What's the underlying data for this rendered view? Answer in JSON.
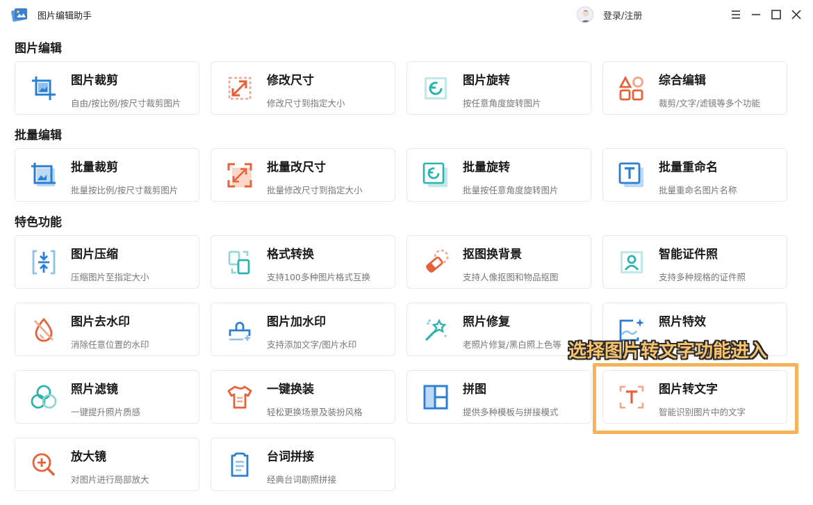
{
  "app": {
    "title": "图片编辑助手",
    "login_label": "登录/注册"
  },
  "sections": [
    {
      "title": "图片编辑"
    },
    {
      "title": "批量编辑"
    },
    {
      "title": "特色功能"
    }
  ],
  "cards": [
    {
      "title": "图片裁剪",
      "desc": "自由/按比例/按尺寸裁剪图片"
    },
    {
      "title": "修改尺寸",
      "desc": "修改尺寸到指定大小"
    },
    {
      "title": "图片旋转",
      "desc": "按任意角度旋转图片"
    },
    {
      "title": "综合编辑",
      "desc": "裁剪/文字/滤镜等多个功能"
    },
    {
      "title": "批量裁剪",
      "desc": "批量按比例/按尺寸裁剪图片"
    },
    {
      "title": "批量改尺寸",
      "desc": "批量修改尺寸到指定大小"
    },
    {
      "title": "批量旋转",
      "desc": "批量按任意角度旋转图片"
    },
    {
      "title": "批量重命名",
      "desc": "批量重命名图片名称"
    },
    {
      "title": "图片压缩",
      "desc": "压缩图片至指定大小"
    },
    {
      "title": "格式转换",
      "desc": "支持100多种图片格式互换"
    },
    {
      "title": "抠图换背景",
      "desc": "支持人像抠图和物品抠图"
    },
    {
      "title": "智能证件照",
      "desc": "支持多种规格的证件照"
    },
    {
      "title": "图片去水印",
      "desc": "消除任意位置的水印"
    },
    {
      "title": "图片加水印",
      "desc": "支持添加文字/图片水印"
    },
    {
      "title": "照片修复",
      "desc": "老照片修复/黑白照上色等"
    },
    {
      "title": "照片特效",
      "desc": ""
    },
    {
      "title": "照片滤镜",
      "desc": "一键提升照片质感"
    },
    {
      "title": "一键换装",
      "desc": "轻松更换场景及装扮风格"
    },
    {
      "title": "拼图",
      "desc": "提供多种模板与拼接模式"
    },
    {
      "title": "图片转文字",
      "desc": "智能识别图片中的文字"
    },
    {
      "title": "放大镜",
      "desc": "对图片进行局部放大"
    },
    {
      "title": "台词拼接",
      "desc": "经典台词剧照拼接"
    }
  ],
  "callout": {
    "text": "选择图片转文字功能进入"
  },
  "colors": {
    "blue": "#2a7fd4",
    "orange": "#e8603a",
    "teal": "#2bb3b0",
    "highlight": "#f7b25a"
  }
}
